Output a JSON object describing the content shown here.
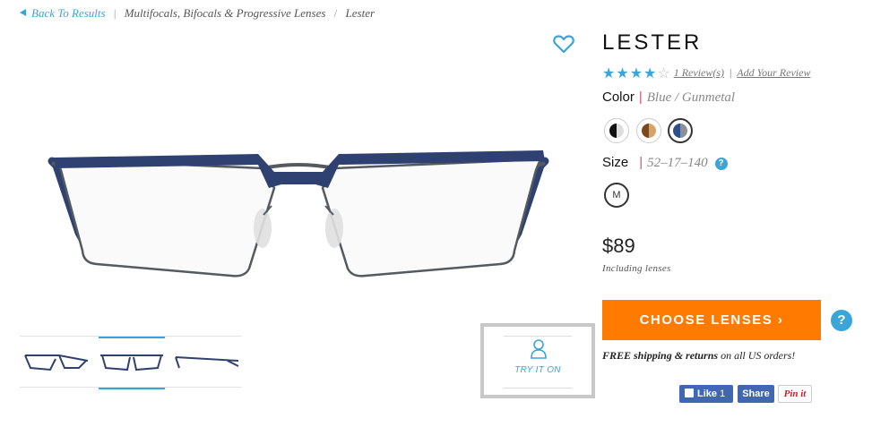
{
  "breadcrumb": {
    "back_label": "Back To Results",
    "category": "Multifocals, Bifocals & Progressive Lenses",
    "current": "Lester"
  },
  "product": {
    "name": "LESTER",
    "rating": 4,
    "rating_max": 5,
    "reviews_label": "1 Review(s)",
    "add_review_label": "Add Your Review",
    "color_label": "Color",
    "color_value": "Blue / Gunmetal",
    "colors": [
      {
        "name": "black",
        "left": "#111111",
        "right": "#dddddd"
      },
      {
        "name": "tortoise",
        "left": "#7a4a1e",
        "right": "#d6a46b"
      },
      {
        "name": "blue-gunmetal",
        "left": "#2d4f8a",
        "right": "#8a8f98"
      }
    ],
    "selected_color": 2,
    "size_label": "Size",
    "size_value": "52–17–140",
    "size_help": "?",
    "size_option": "M",
    "price": "$89",
    "price_note": "Including lenses"
  },
  "actions": {
    "choose_lenses": "CHOOSE LENSES ›",
    "help": "?",
    "try_on": "TRY IT ON"
  },
  "shipping": {
    "bold": "FREE shipping & returns",
    "rest": " on all US orders!"
  },
  "social": {
    "like_label": "Like",
    "like_count": "1",
    "share_label": "Share",
    "pin_label": "Pin it"
  },
  "colors": {
    "accent": "#3aa5d8",
    "cta": "#ff7a00",
    "frame_blue": "#2e4170",
    "frame_metal": "#555a60"
  },
  "icons": [
    "heart-icon",
    "back-triangle-icon",
    "star-icon",
    "person-icon",
    "help-icon",
    "facebook-thumb-icon"
  ]
}
